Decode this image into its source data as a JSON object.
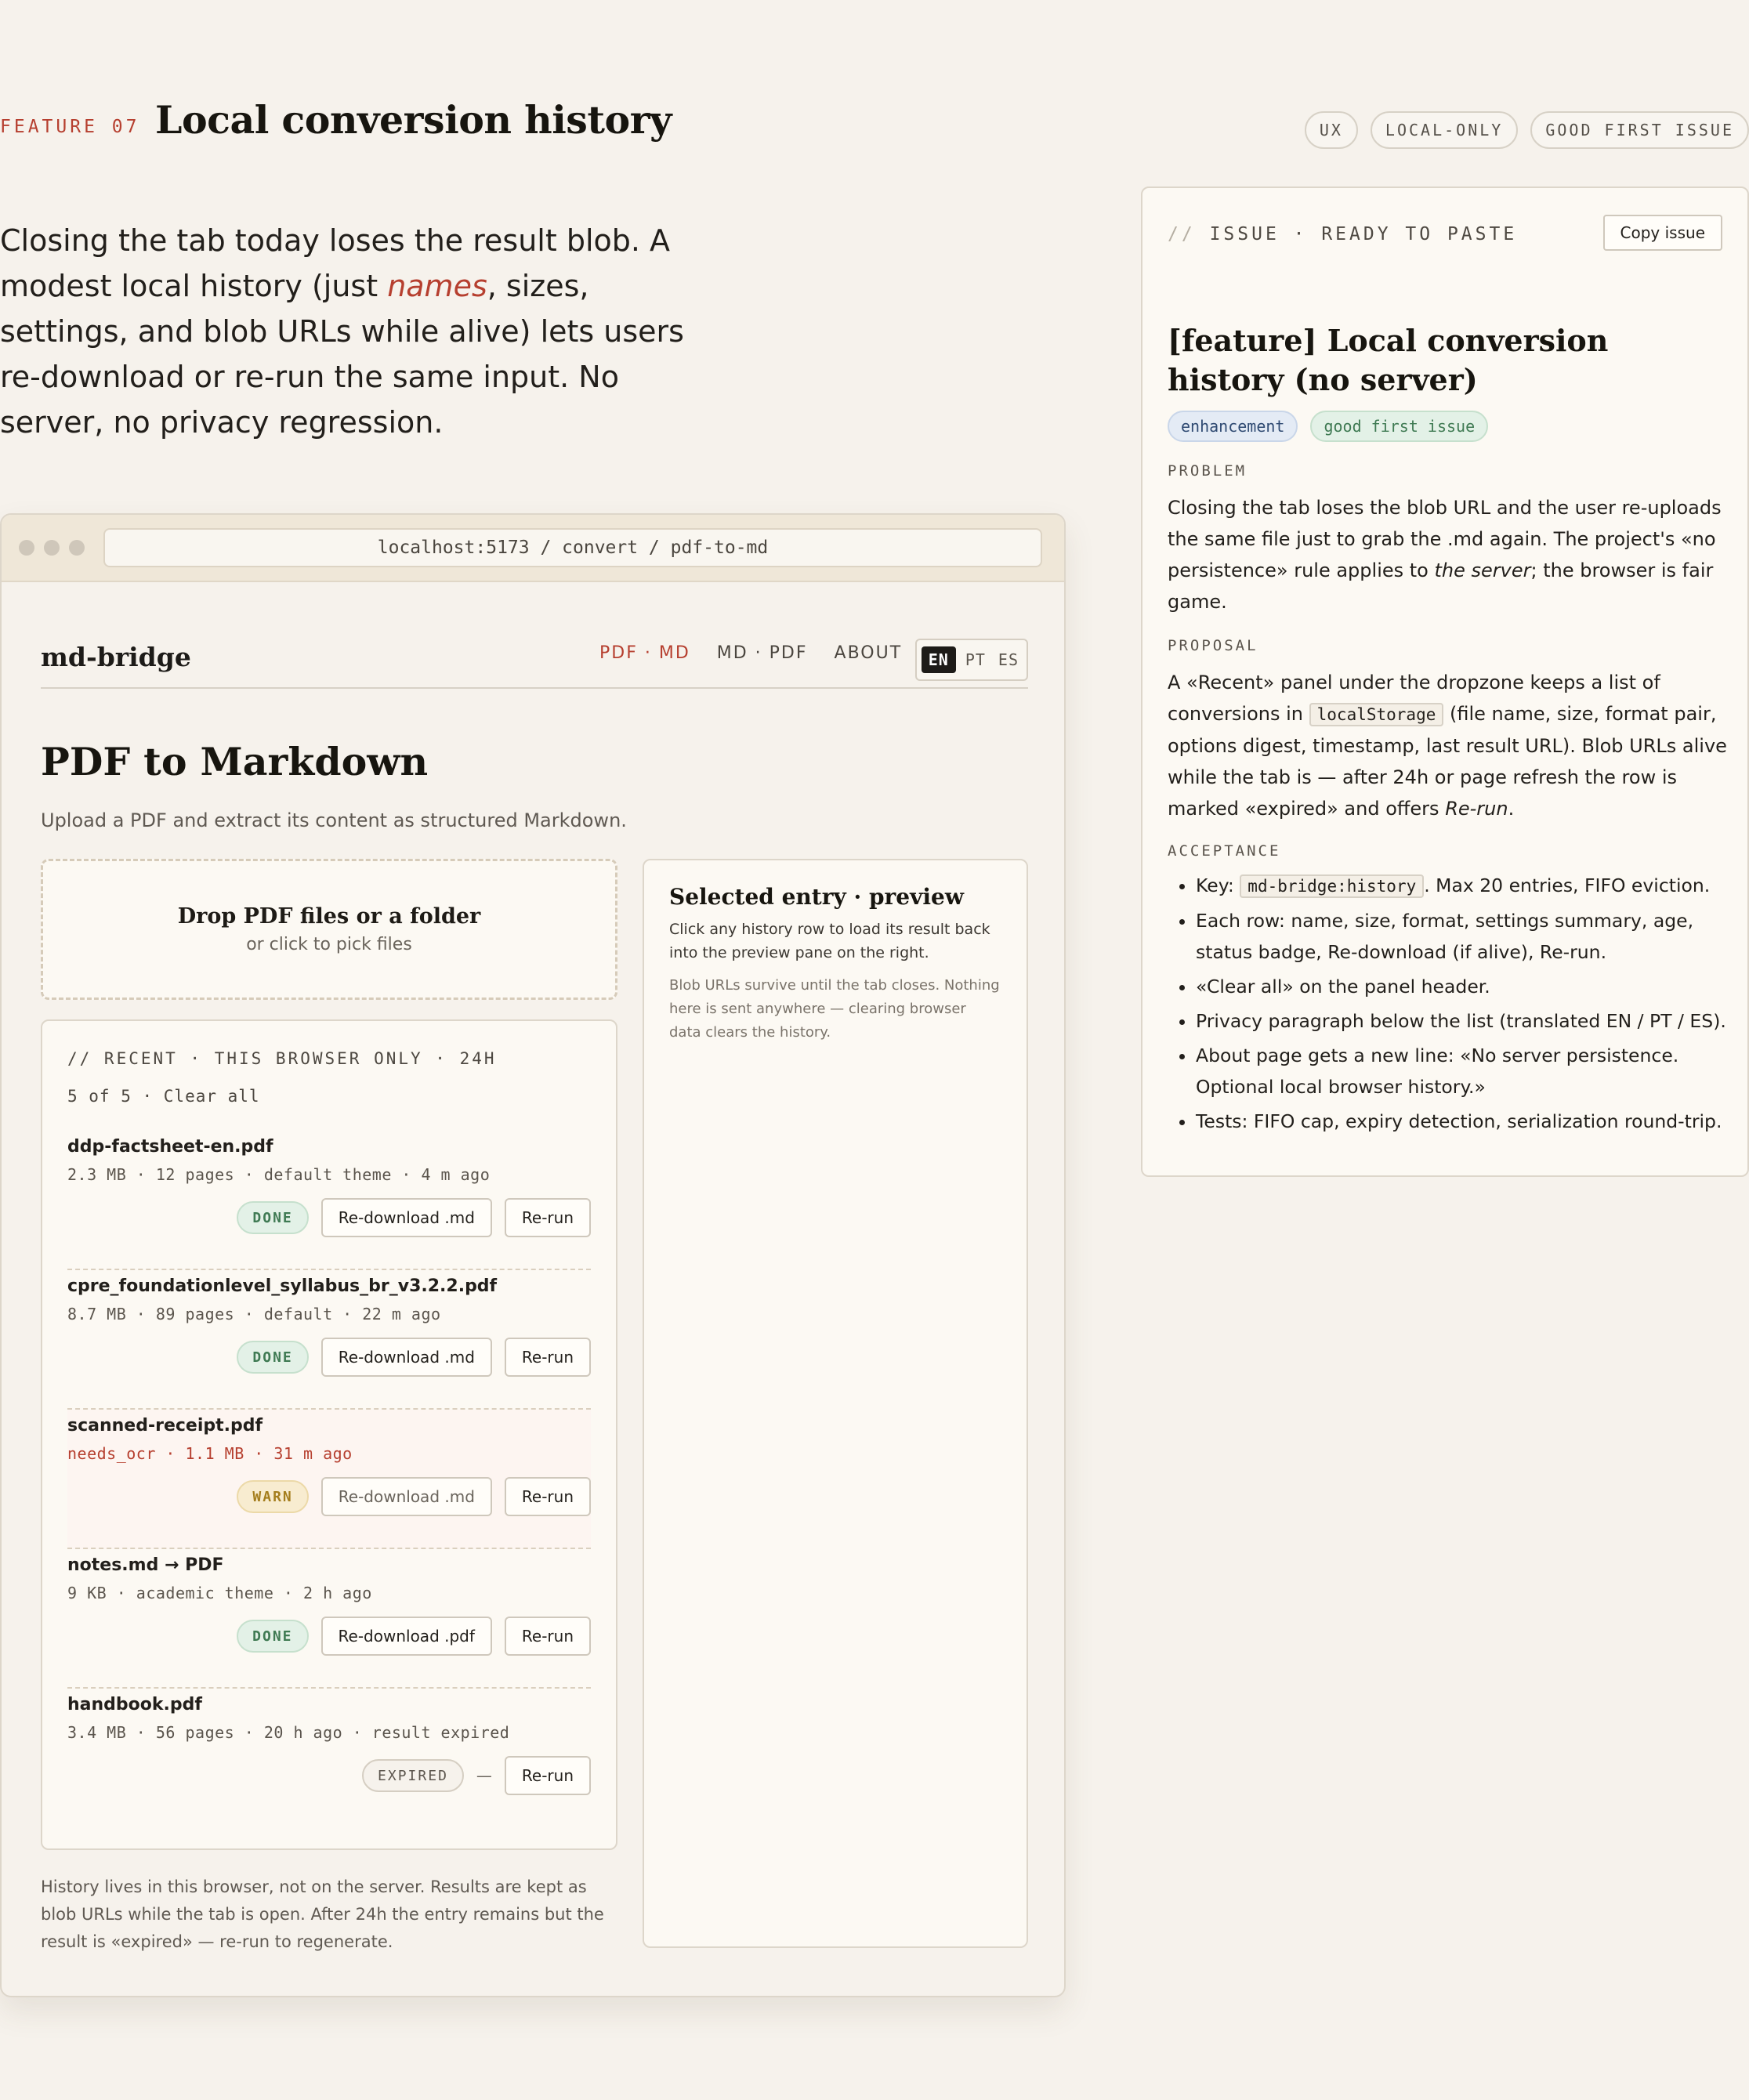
{
  "header": {
    "feature_label": "FEATURE 07",
    "title": "Local conversion history",
    "tags": [
      "UX",
      "LOCAL-ONLY",
      "GOOD FIRST ISSUE"
    ]
  },
  "intro": {
    "before": "Closing the tab today loses the result blob. A modest local history (just ",
    "emphasis": "names",
    "after": ", sizes, settings, and blob URLs while alive) lets users re-download or re-run the same input. No server, no privacy regression."
  },
  "browser": {
    "url": "localhost:5173 / convert / pdf-to-md"
  },
  "app": {
    "brand": "md-bridge",
    "nav": [
      "PDF · MD",
      "MD · PDF",
      "ABOUT"
    ],
    "languages": [
      "EN",
      "PT",
      "ES"
    ],
    "title": "PDF to Markdown",
    "subtitle": "Upload a PDF and extract its content as structured Markdown.",
    "dropzone": {
      "title": "Drop PDF files or a folder",
      "sub": "or click to pick files"
    },
    "history": {
      "heading": "// RECENT · THIS BROWSER ONLY · 24H",
      "count": "5 of 5 · Clear all",
      "rows": [
        {
          "name": "ddp-factsheet-en.pdf",
          "meta": "2.3 MB · 12 pages · default theme · 4 m ago",
          "badge": "DONE",
          "download": "Re-download .md",
          "rerun": "Re-run"
        },
        {
          "name": "cpre_foundationlevel_syllabus_br_v3.2.2.pdf",
          "meta": "8.7 MB · 89 pages · default · 22 m ago",
          "badge": "DONE",
          "download": "Re-download .md",
          "rerun": "Re-run"
        },
        {
          "name": "scanned-receipt.pdf",
          "meta": "needs_ocr · 1.1 MB · 31 m ago",
          "badge": "WARN",
          "download": "Re-download .md",
          "rerun": "Re-run"
        },
        {
          "name": "notes.md → PDF",
          "meta": "9 KB · academic theme · 2 h ago",
          "badge": "DONE",
          "download": "Re-download .pdf",
          "rerun": "Re-run"
        },
        {
          "name": "handbook.pdf",
          "meta": "3.4 MB · 56 pages · 20 h ago · result expired",
          "badge": "EXPIRED",
          "download": "—",
          "rerun": "Re-run"
        }
      ]
    },
    "footnote": "History lives in this browser, not on the server. Results are kept as blob URLs while the tab is open. After 24h the entry remains but the result is «expired» — re-run to regenerate.",
    "preview": {
      "title": "Selected entry · preview",
      "text": "Click any history row to load its result back into the preview pane on the right.",
      "note": "Blob URLs survive until the tab closes. Nothing here is sent anywhere — clearing browser data clears the history."
    }
  },
  "issue": {
    "slash": "//",
    "head": "ISSUE · READY TO PASTE",
    "copy": "Copy issue",
    "title": "[feature] Local conversion history (no server)",
    "labels": [
      "enhancement",
      "good first issue"
    ],
    "problem_label": "PROBLEM",
    "problem_before": "Closing the tab loses the blob URL and the user re-uploads the same file just to grab the .md again. The project's «no persistence» rule applies to ",
    "problem_em": "the server",
    "problem_after": "; the browser is fair game.",
    "proposal_label": "PROPOSAL",
    "proposal_a": "A «Recent» panel under the dropzone keeps a list of conversions in ",
    "proposal_code": "localStorage",
    "proposal_b": " (file name, size, format pair, options digest, timestamp, last result URL). Blob URLs alive while the tab is — after 24h or page refresh the row is marked «expired» and offers ",
    "proposal_em": "Re-run",
    "proposal_c": ".",
    "acceptance_label": "ACCEPTANCE",
    "acc_key_a": "Key: ",
    "acc_key_code": "md-bridge:history",
    "acc_key_b": ". Max 20 entries, FIFO eviction.",
    "acceptance": [
      "Each row: name, size, format, settings summary, age, status badge, Re-download (if alive), Re-run.",
      "«Clear all» on the panel header.",
      "Privacy paragraph below the list (translated EN / PT / ES).",
      "About page gets a new line: «No server persistence. Optional local browser history.»",
      "Tests: FIFO cap, expiry detection, serialization round-trip."
    ]
  }
}
